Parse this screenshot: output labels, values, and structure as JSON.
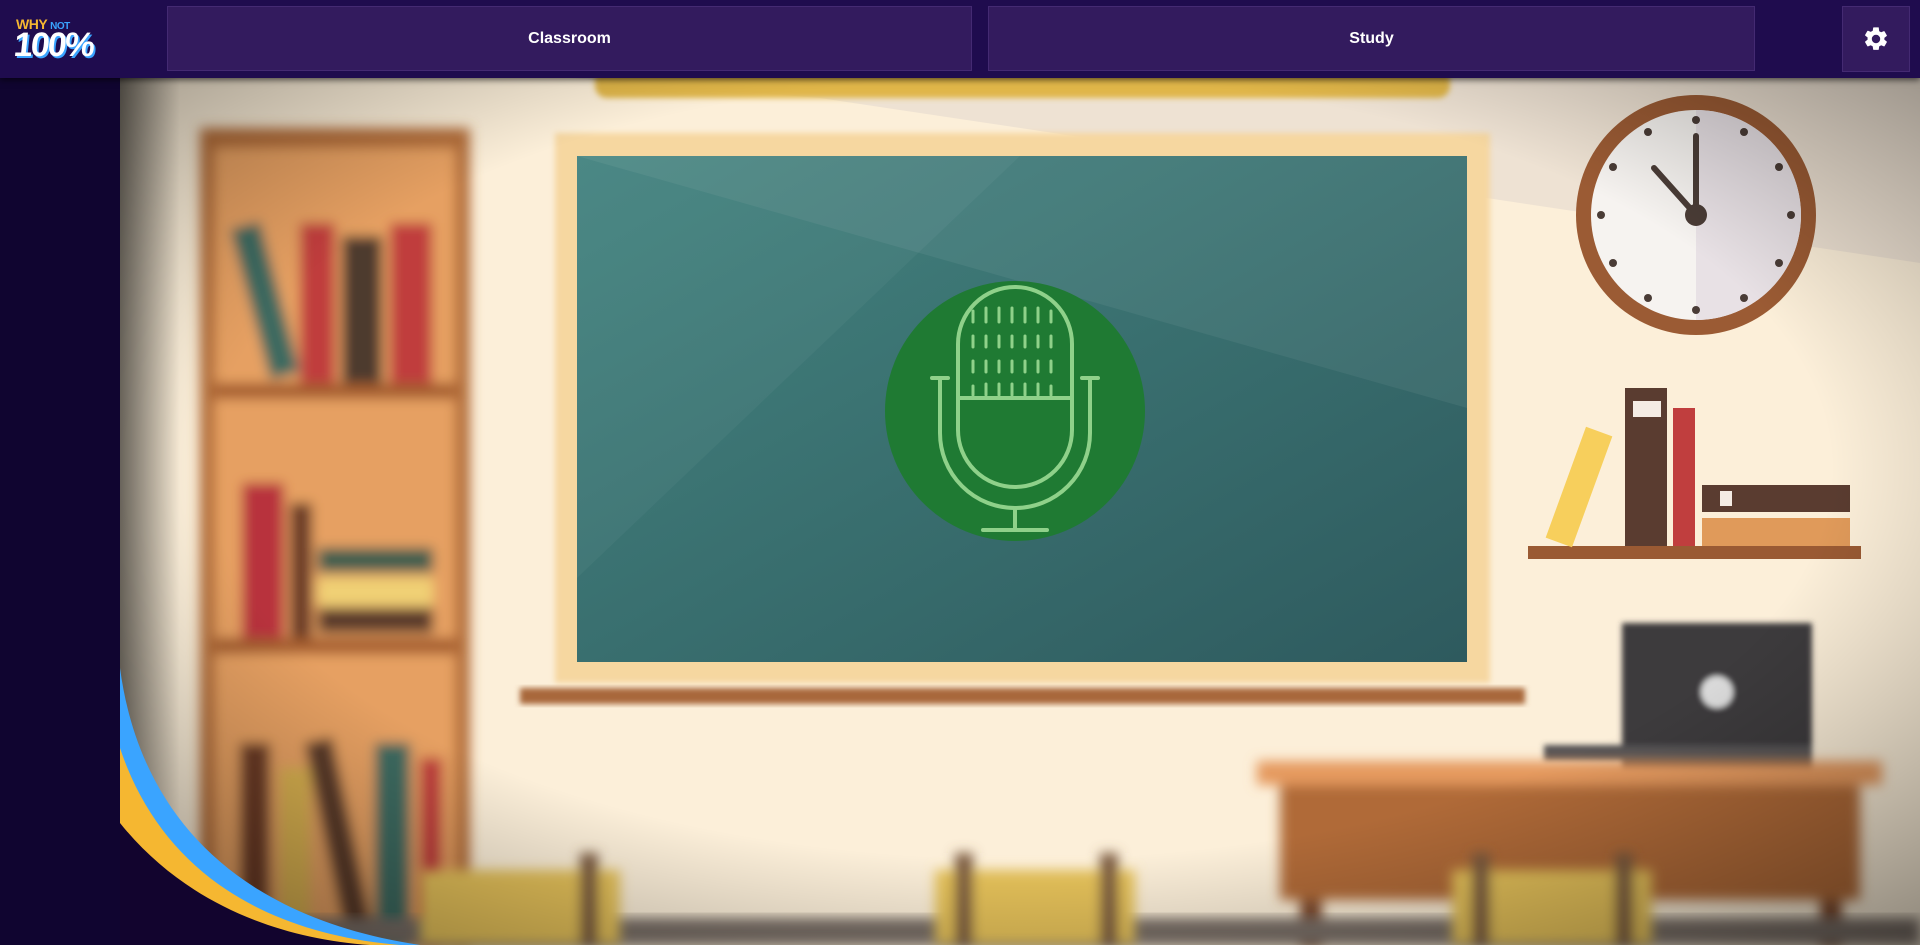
{
  "logo": {
    "line1_a": "WHY",
    "line1_b": "NOT",
    "line2": "100%"
  },
  "nav": {
    "classroom_label": "Classroom",
    "study_label": "Study"
  },
  "settings": {
    "icon": "gear-icon"
  },
  "scene": {
    "mic_icon": "microphone-icon",
    "colors": {
      "chalkboard": "#3c7474",
      "mic_circle": "#1f7a33",
      "mic_stroke": "#8fd18a",
      "wall": "#fcefd9",
      "accent_blue": "#3aa4ff",
      "accent_yellow": "#f5b731"
    }
  }
}
